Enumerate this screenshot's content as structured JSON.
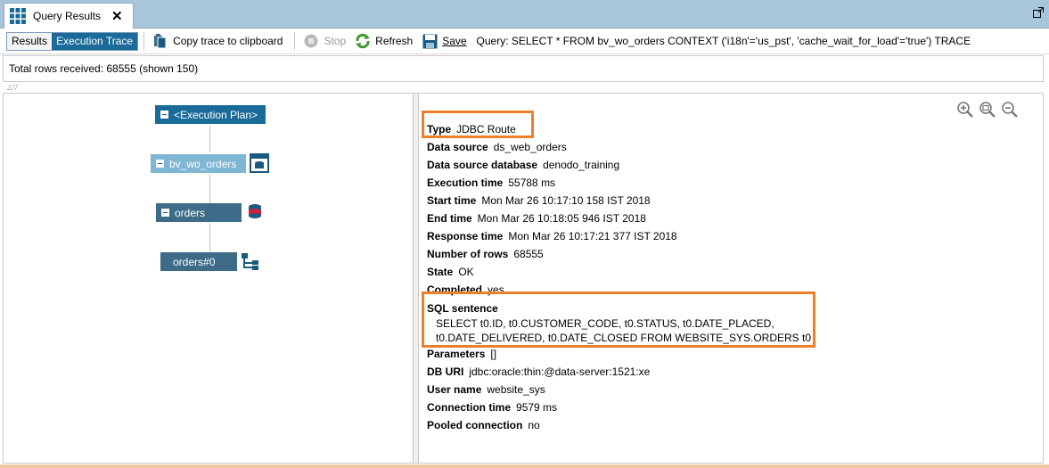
{
  "tab": {
    "title": "Query Results",
    "close": "✕"
  },
  "toolbar": {
    "results_label": "Results",
    "trace_label": "Execution Trace",
    "copy_label": "Copy trace to clipboard",
    "stop_label": "Stop",
    "refresh_label": "Refresh",
    "save_label": "Save",
    "query_text": "Query: SELECT * FROM bv_wo_orders CONTEXT ('i18n'='us_pst', 'cache_wait_for_load'='true') TRACE"
  },
  "info": {
    "rows_text": "Total rows received: 68555 (shown 150)"
  },
  "tree": {
    "root": "<Execution Plan>",
    "view": "bv_wo_orders",
    "datasource": "orders",
    "route": "orders#0"
  },
  "properties": [
    {
      "key": "Type",
      "value": "JDBC Route"
    },
    {
      "key": "Data source",
      "value": "ds_web_orders"
    },
    {
      "key": "Data source database",
      "value": "denodo_training"
    },
    {
      "key": "Execution time",
      "value": "55788 ms"
    },
    {
      "key": "Start time",
      "value": "Mon Mar 26 10:17:10 158 IST 2018"
    },
    {
      "key": "End time",
      "value": "Mon Mar 26 10:18:05 946 IST 2018"
    },
    {
      "key": "Response time",
      "value": "Mon Mar 26 10:17:21 377 IST 2018"
    },
    {
      "key": "Number of rows",
      "value": "68555"
    },
    {
      "key": "State",
      "value": "OK"
    },
    {
      "key": "Completed",
      "value": "yes"
    }
  ],
  "sql": {
    "key": "SQL sentence",
    "line1": "SELECT t0.ID, t0.CUSTOMER_CODE, t0.STATUS, t0.DATE_PLACED,",
    "line2": "t0.DATE_DELIVERED, t0.DATE_CLOSED FROM WEBSITE_SYS.ORDERS t0"
  },
  "properties2": [
    {
      "key": "Parameters",
      "value": "[]"
    },
    {
      "key": "DB URI",
      "value": "jdbc:oracle:thin:@data-server:1521:xe"
    },
    {
      "key": "User name",
      "value": "website_sys"
    },
    {
      "key": "Connection time",
      "value": "9579 ms"
    },
    {
      "key": "Pooled connection",
      "value": "no"
    }
  ],
  "colors": {
    "highlight": "#f07f2a",
    "tab_bar": "#a8c6db",
    "active_button": "#1a6b9a"
  }
}
